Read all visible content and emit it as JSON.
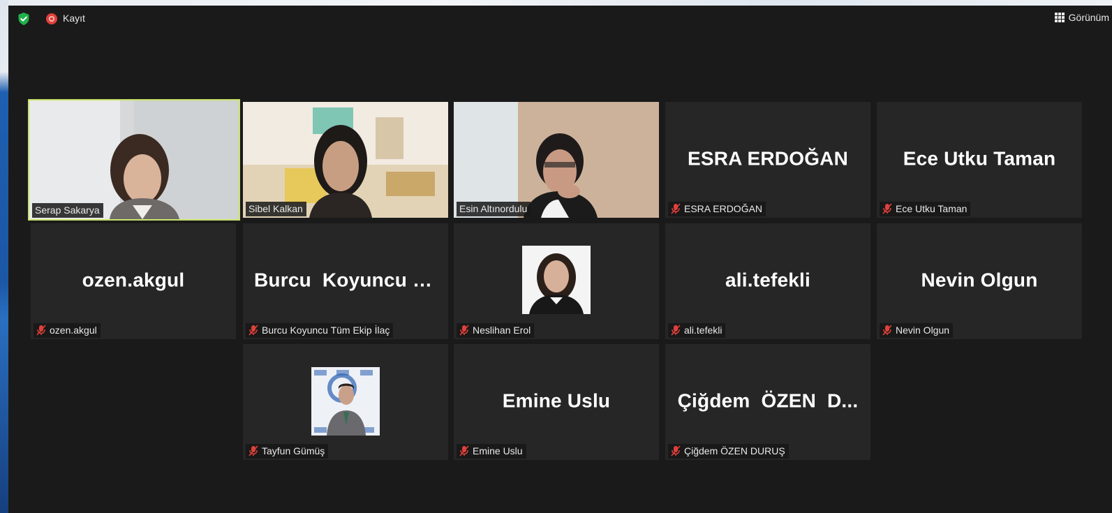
{
  "toolbar": {
    "record_label": "Kayıt",
    "view_label": "Görünüm",
    "shield_icon": "shield-check-icon",
    "record_icon": "record-icon",
    "view_icon": "grid-icon",
    "colors": {
      "shield": "#20b04b",
      "record": "#e0403a",
      "active_speaker": "#c8e36a"
    }
  },
  "participants": [
    {
      "nameplate": "Serap Sakarya",
      "video": true,
      "active": true,
      "muted": false
    },
    {
      "nameplate": "Sibel Kalkan",
      "video": true,
      "muted": false
    },
    {
      "nameplate": "Esin Altınordulu",
      "video": true,
      "muted": false
    },
    {
      "display_name": "ESRA ERDOĞAN",
      "nameplate": "ESRA ERDOĞAN",
      "muted": true
    },
    {
      "display_name": "Ece Utku Taman",
      "nameplate": "Ece Utku Taman",
      "muted": true
    },
    {
      "display_name": "ozen.akgul",
      "nameplate": "ozen.akgul",
      "muted": true
    },
    {
      "display_name": "Burcu  Koyuncu  T...",
      "nameplate": "Burcu Koyuncu Tüm Ekip İlaç",
      "muted": true
    },
    {
      "nameplate": "Neslihan Erol",
      "photo": true,
      "muted": true
    },
    {
      "display_name": "ali.tefekli",
      "nameplate": "ali.tefekli",
      "muted": true
    },
    {
      "display_name": "Nevin Olgun",
      "nameplate": "Nevin Olgun",
      "muted": true
    },
    {
      "nameplate": "Tayfun Gümüş",
      "photo": true,
      "muted": true
    },
    {
      "display_name": "Emine Uslu",
      "nameplate": "Emine Uslu",
      "muted": true
    },
    {
      "display_name": "Çiğdem  ÖZEN  D...",
      "nameplate": "Çiğdem ÖZEN DURUŞ",
      "muted": true
    }
  ]
}
